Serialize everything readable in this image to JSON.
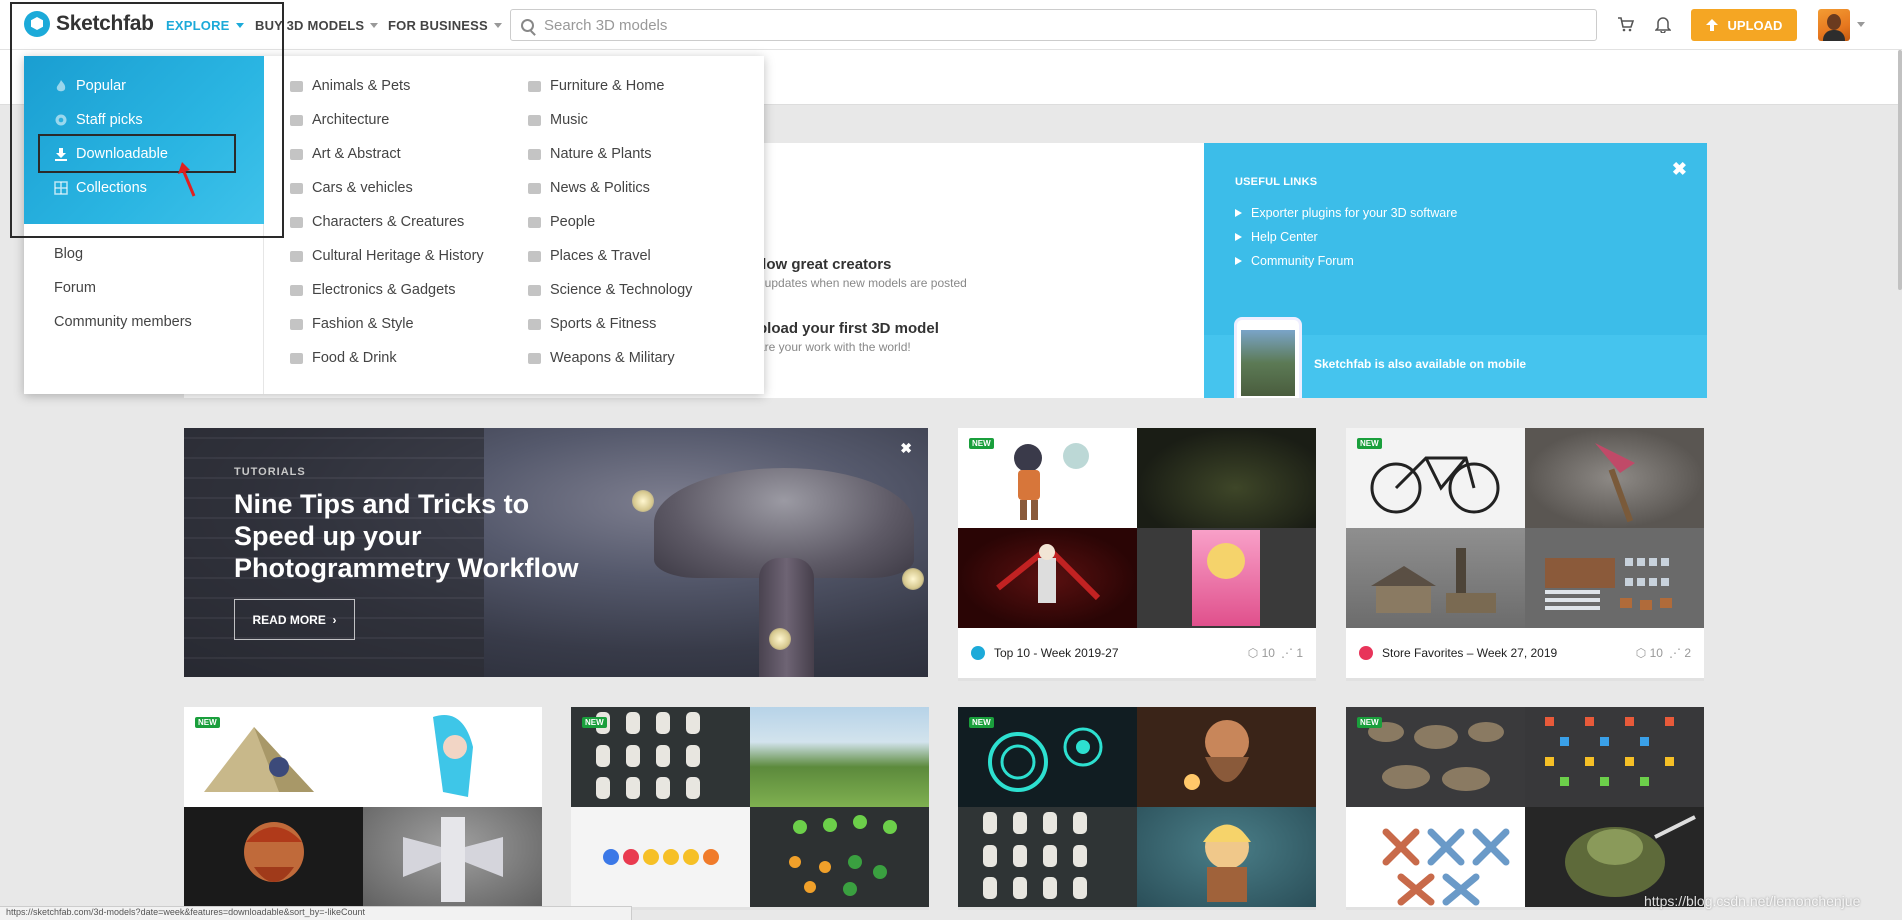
{
  "header": {
    "brand": "Sketchfab",
    "nav": [
      {
        "label": "EXPLORE"
      },
      {
        "label": "BUY 3D MODELS"
      },
      {
        "label": "FOR BUSINESS"
      }
    ],
    "search_placeholder": "Search 3D models",
    "upload_label": "UPLOAD"
  },
  "explore_menu": {
    "primary": [
      {
        "label": "Popular",
        "icon": "flame-icon"
      },
      {
        "label": "Staff picks",
        "icon": "badge-icon"
      },
      {
        "label": "Downloadable",
        "icon": "download-icon"
      },
      {
        "label": "Collections",
        "icon": "grid-icon"
      }
    ],
    "secondary": [
      "Blog",
      "Forum",
      "Community members"
    ],
    "categories_col1": [
      "Animals & Pets",
      "Architecture",
      "Art & Abstract",
      "Cars & vehicles",
      "Characters & Creatures",
      "Cultural Heritage & History",
      "Electronics & Gadgets",
      "Fashion & Style",
      "Food & Drink"
    ],
    "categories_col2": [
      "Furniture & Home",
      "Music",
      "Nature & Plants",
      "News & Politics",
      "People",
      "Places & Travel",
      "Science & Technology",
      "Sports & Fitness",
      "Weapons & Military"
    ]
  },
  "welcome": {
    "follow_title": "llow great creators",
    "follow_sub": "t updates when new models are posted",
    "upload_title": "pload your first 3D model",
    "upload_sub": "are your work with the world!"
  },
  "useful_links": {
    "heading": "USEFUL LINKS",
    "links": [
      "Exporter plugins for your 3D software",
      "Help Center",
      "Community Forum"
    ],
    "mobile": "Sketchfab is also available on mobile",
    "close": "✖"
  },
  "banner": {
    "tag": "TUTORIALS",
    "title": "Nine Tips and Tricks to Speed up your Photogrammetry Workflow",
    "button": "READ MORE",
    "close": "✖"
  },
  "collections": [
    {
      "title": "Top 10 - Week 2019-27",
      "models": "10",
      "likes": "1",
      "new": "NEW",
      "icon_color": "#1caad9"
    },
    {
      "title": "Store Favorites – Week 27, 2019",
      "models": "10",
      "likes": "2",
      "new": "NEW",
      "icon_color": "#e8345a"
    }
  ],
  "new_badge": "NEW",
  "watermark": "https://blog.csdn.net/lemonchenjue",
  "status_url": "https://sketchfab.com/3d-models?date=week&features=downloadable&sort_by=-likeCount"
}
